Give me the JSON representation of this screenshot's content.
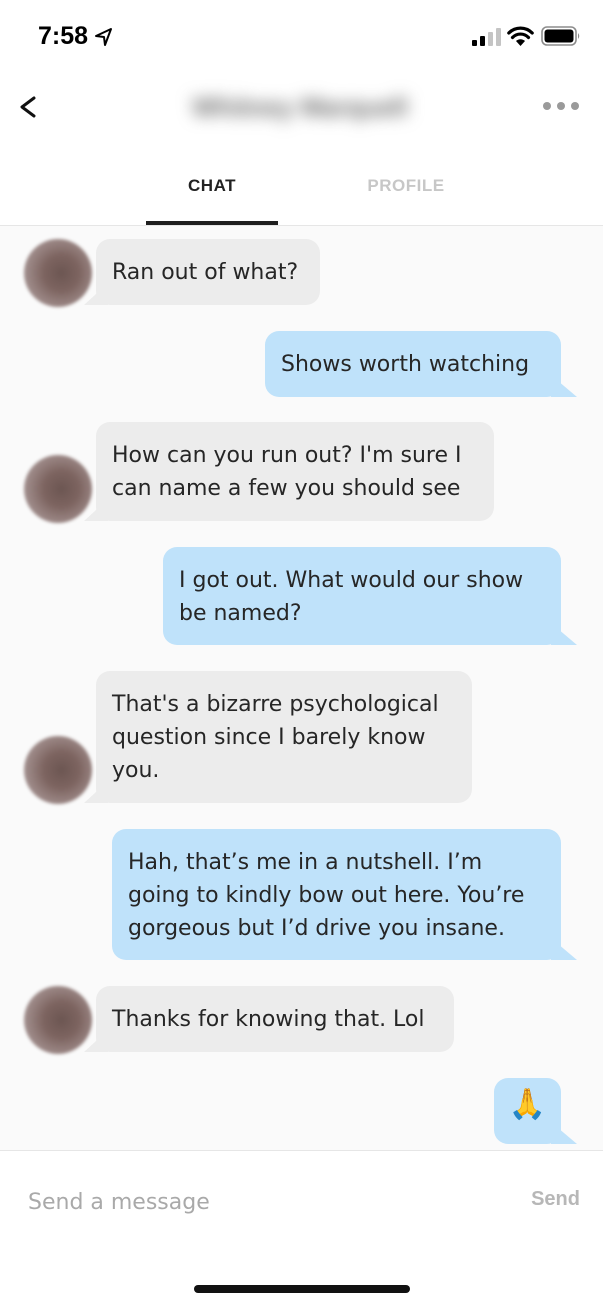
{
  "status_bar": {
    "time": "7:58"
  },
  "header": {
    "contact_name": "Whitney Marquell"
  },
  "tabs": [
    {
      "label": "CHAT",
      "active": true
    },
    {
      "label": "PROFILE",
      "active": false
    }
  ],
  "messages": [
    {
      "direction": "incoming",
      "text": "Ran out of what?"
    },
    {
      "direction": "outgoing",
      "text": "Shows worth watching"
    },
    {
      "direction": "incoming",
      "text": "How can you run out? I'm sure I\ncan name a few you should see"
    },
    {
      "direction": "outgoing",
      "text": "I got out. What would our show\nbe named?"
    },
    {
      "direction": "incoming",
      "text": "That's a bizarre psychological\nquestion since I barely know\nyou."
    },
    {
      "direction": "outgoing",
      "text": "Hah, that’s me in a nutshell. I’m\ngoing to kindly bow out here. You’re\ngorgeous but I’d drive you insane."
    },
    {
      "direction": "incoming",
      "text": "Thanks for knowing that. Lol"
    },
    {
      "direction": "outgoing",
      "text": "🙏"
    }
  ],
  "composer": {
    "placeholder": "Send a message",
    "send_label": "Send"
  },
  "colors": {
    "incoming_bubble": "#ececec",
    "outgoing_bubble": "#bfe2fa"
  },
  "icons": [
    "location-arrow-icon",
    "cellular-signal-icon",
    "wifi-icon",
    "battery-icon",
    "back-chevron-icon",
    "more-options-icon",
    "avatar"
  ]
}
